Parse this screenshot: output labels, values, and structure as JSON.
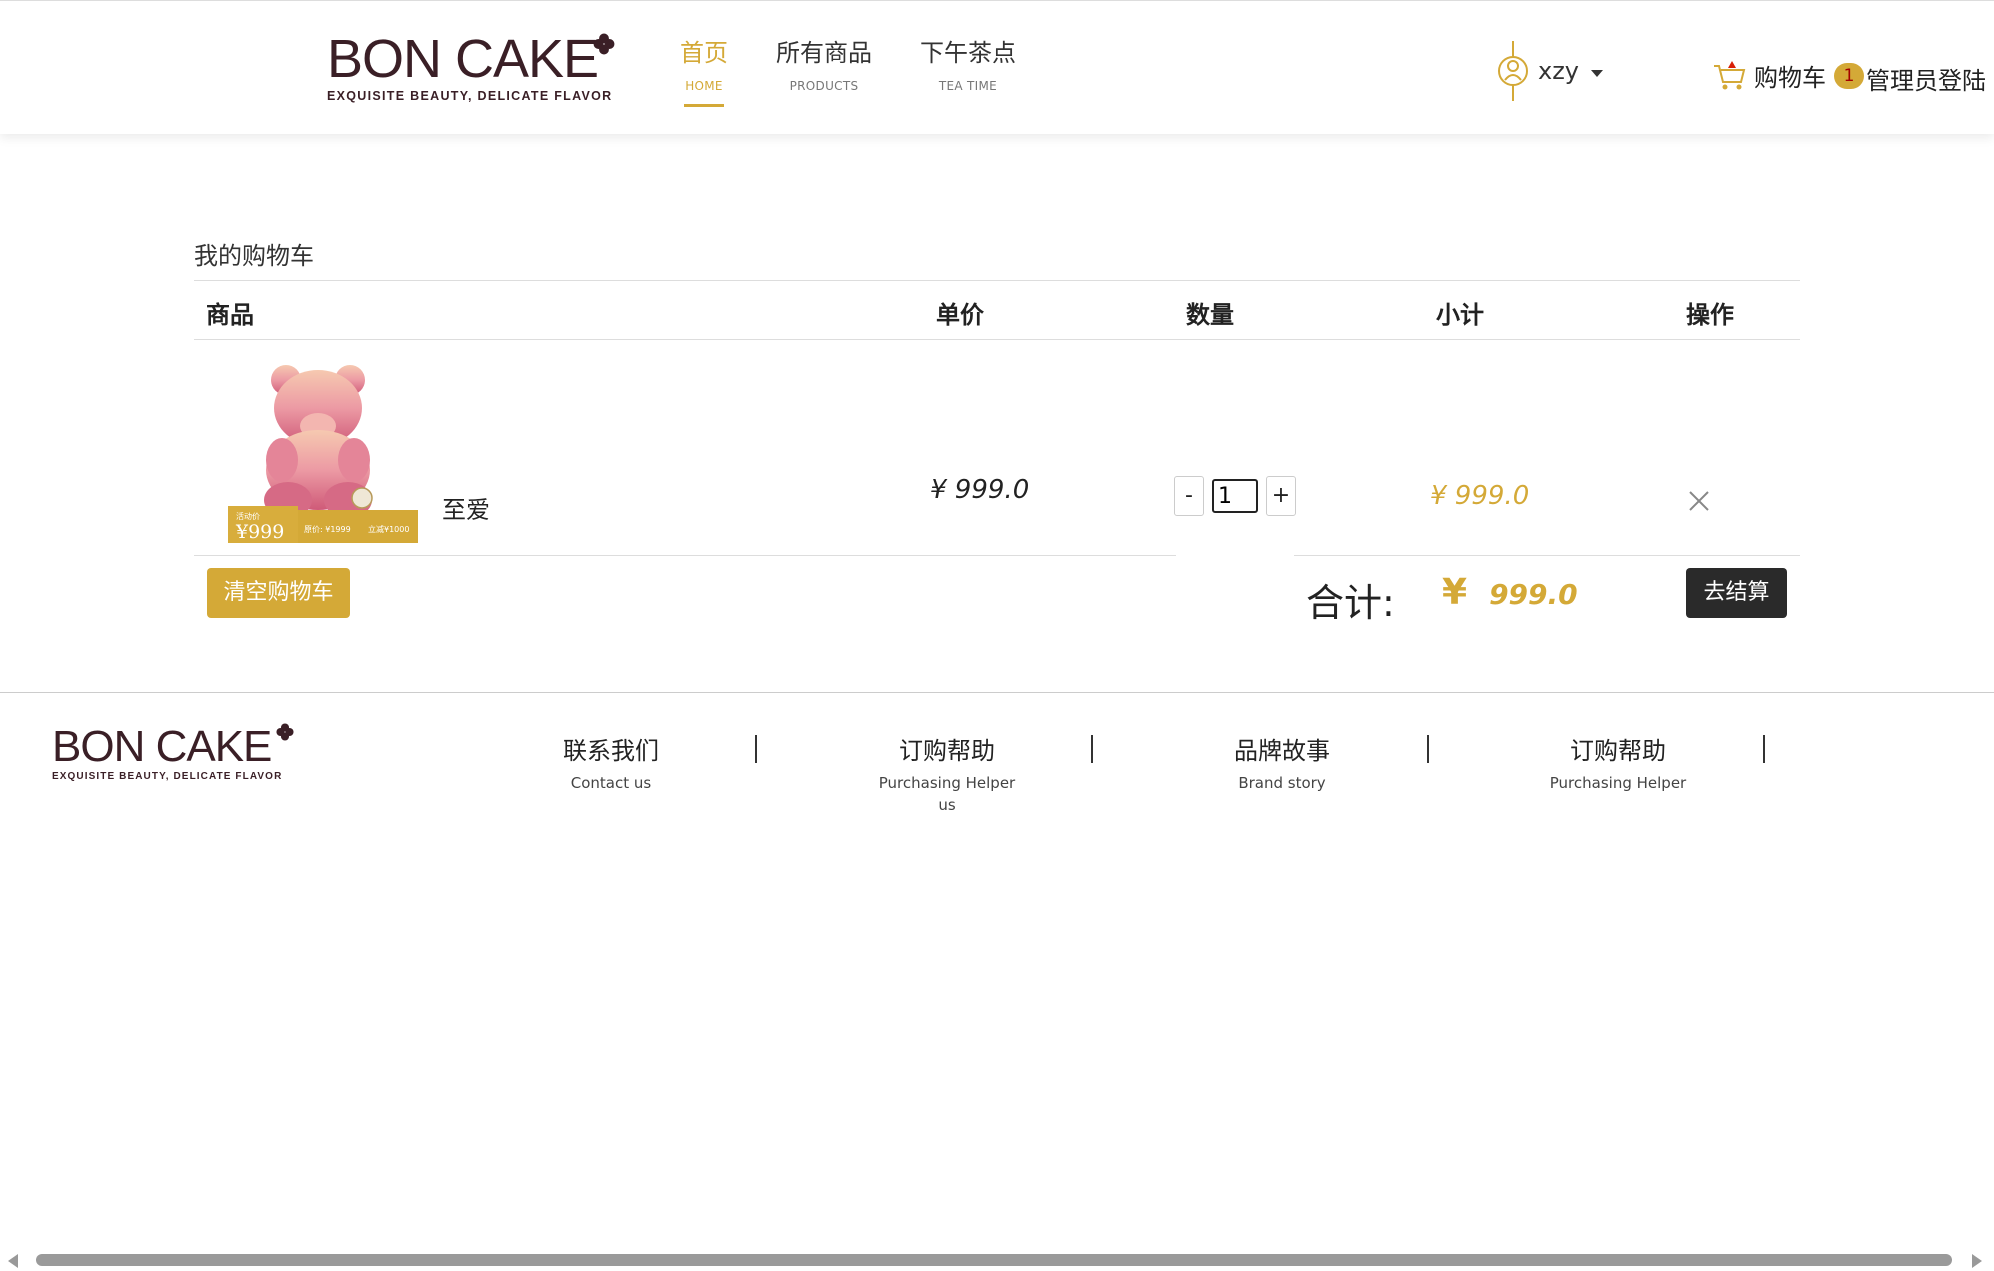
{
  "brand": {
    "name": "BON CAKE",
    "tagline": "EXQUISITE BEAUTY, DELICATE FLAVOR",
    "color": "#3a1f26",
    "accent": "#d4a937"
  },
  "nav": [
    {
      "cn": "首页",
      "en": "HOME",
      "active": true
    },
    {
      "cn": "所有商品",
      "en": "PRODUCTS",
      "active": false
    },
    {
      "cn": "下午茶点",
      "en": "TEA TIME",
      "active": false
    }
  ],
  "user": {
    "name": "xzy",
    "icon": "user-icon"
  },
  "cart_link": {
    "label": "购物车",
    "count": "1",
    "icon": "cart-icon"
  },
  "admin_login": "管理员登陆",
  "cart": {
    "title": "我的购物车",
    "columns": {
      "product": "商品",
      "unit_price": "单价",
      "quantity": "数量",
      "subtotal": "小计",
      "action": "操作"
    },
    "items": [
      {
        "name": "至爱",
        "unit_price": "¥ 999.0",
        "quantity": "1",
        "subtotal": "¥ 999.0",
        "image_caption": {
          "tag": "活动价",
          "price": "¥999",
          "orig": "原价: ¥1999",
          "save": "立减¥1000"
        }
      }
    ],
    "minus": "-",
    "plus": "+",
    "clear_label": "清空购物车",
    "total_label": "合计:",
    "total_currency": "¥",
    "total_value": "999.0",
    "checkout_label": "去结算"
  },
  "footer": {
    "links": [
      {
        "cn": "联系我们",
        "en": "Contact us"
      },
      {
        "cn": "订购帮助",
        "en": "Purchasing Helper us"
      },
      {
        "cn": "品牌故事",
        "en": "Brand story"
      },
      {
        "cn": "订购帮助",
        "en": "Purchasing Helper"
      }
    ]
  }
}
